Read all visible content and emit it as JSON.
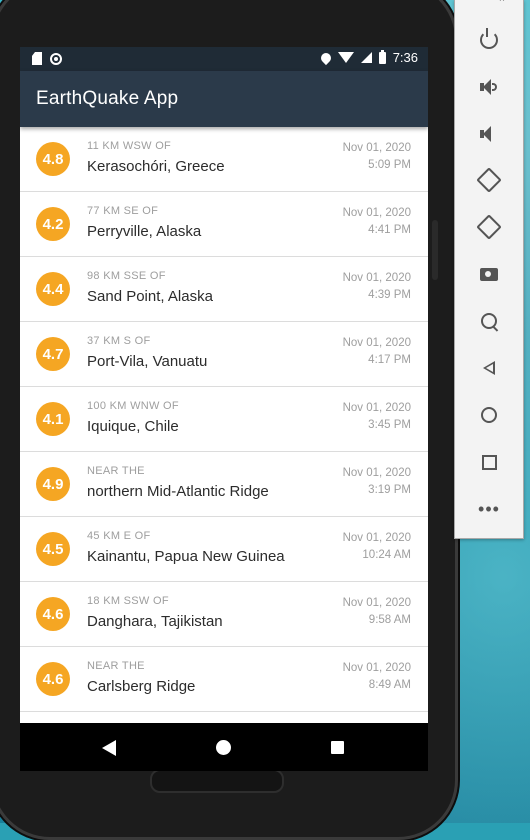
{
  "status_bar": {
    "time": "7:36"
  },
  "app_bar": {
    "title": "EarthQuake App"
  },
  "earthquakes": [
    {
      "magnitude": "4.8",
      "offset": "11 KM WSW OF",
      "place": "Kerasochóri, Greece",
      "date": "Nov 01, 2020",
      "time": "5:09 PM"
    },
    {
      "magnitude": "4.2",
      "offset": "77 KM SE OF",
      "place": "Perryville, Alaska",
      "date": "Nov 01, 2020",
      "time": "4:41 PM"
    },
    {
      "magnitude": "4.4",
      "offset": "98 KM SSE OF",
      "place": "Sand Point, Alaska",
      "date": "Nov 01, 2020",
      "time": "4:39 PM"
    },
    {
      "magnitude": "4.7",
      "offset": "37 KM S OF",
      "place": "Port-Vila, Vanuatu",
      "date": "Nov 01, 2020",
      "time": "4:17 PM"
    },
    {
      "magnitude": "4.1",
      "offset": "100 KM WNW OF",
      "place": "Iquique, Chile",
      "date": "Nov 01, 2020",
      "time": "3:45 PM"
    },
    {
      "magnitude": "4.9",
      "offset": "NEAR THE",
      "place": "northern Mid-Atlantic Ridge",
      "date": "Nov 01, 2020",
      "time": "3:19 PM"
    },
    {
      "magnitude": "4.5",
      "offset": "45 KM E OF",
      "place": "Kainantu, Papua New Guinea",
      "date": "Nov 01, 2020",
      "time": "10:24 AM"
    },
    {
      "magnitude": "4.6",
      "offset": "18 KM SSW OF",
      "place": "Danghara, Tajikistan",
      "date": "Nov 01, 2020",
      "time": "9:58 AM"
    },
    {
      "magnitude": "4.6",
      "offset": "NEAR THE",
      "place": "Carlsberg Ridge",
      "date": "Nov 01, 2020",
      "time": "8:49 AM"
    }
  ],
  "colors": {
    "app_bar": "#2b3a4a",
    "status_bar": "#1f2b36",
    "magnitude_badge": "#f5a623"
  },
  "emulator_toolbar": {
    "buttons": [
      "power-icon",
      "volume-up-icon",
      "volume-down-icon",
      "rotate-left-icon",
      "rotate-right-icon",
      "camera-icon",
      "zoom-icon",
      "back-icon",
      "home-icon",
      "overview-icon",
      "more-icon"
    ],
    "window_controls": [
      "minimize-icon",
      "close-icon"
    ],
    "minimize_glyph": "–",
    "close_glyph": "×",
    "more_glyph": "•••"
  }
}
